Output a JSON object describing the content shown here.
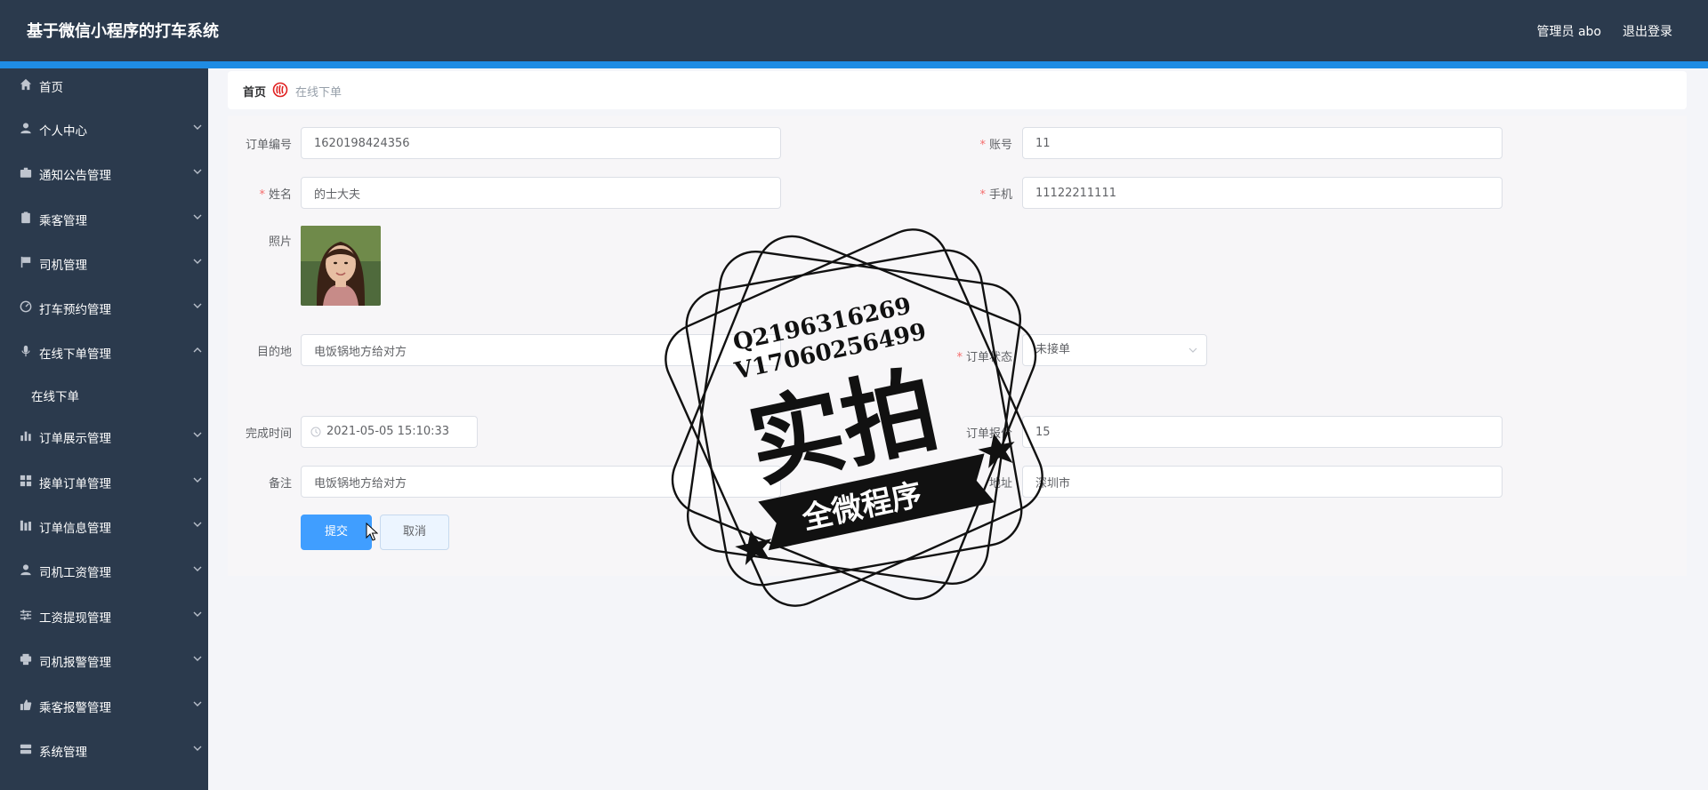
{
  "header": {
    "title": "基于微信小程序的打车系统",
    "user": "管理员 abo",
    "logout": "退出登录"
  },
  "sidebar": {
    "items": [
      {
        "label": "首页",
        "icon": "home-icon"
      },
      {
        "label": "个人中心",
        "icon": "user-icon"
      },
      {
        "label": "通知公告管理",
        "icon": "briefcase-icon"
      },
      {
        "label": "乘客管理",
        "icon": "clipboard-icon"
      },
      {
        "label": "司机管理",
        "icon": "flag-icon"
      },
      {
        "label": "打车预约管理",
        "icon": "gauge-icon"
      },
      {
        "label": "在线下单管理",
        "icon": "mic-icon"
      },
      {
        "label": "在线下单",
        "icon": ""
      },
      {
        "label": "订单展示管理",
        "icon": "bar-chart-icon"
      },
      {
        "label": "接单订单管理",
        "icon": "grid-icon"
      },
      {
        "label": "订单信息管理",
        "icon": "columns-icon"
      },
      {
        "label": "司机工资管理",
        "icon": "user-icon"
      },
      {
        "label": "工资提现管理",
        "icon": "sliders-icon"
      },
      {
        "label": "司机报警管理",
        "icon": "printer-icon"
      },
      {
        "label": "乘客报警管理",
        "icon": "thumb-icon"
      },
      {
        "label": "系统管理",
        "icon": "server-icon"
      }
    ]
  },
  "breadcrumb": {
    "home": "首页",
    "current": "在线下单"
  },
  "form": {
    "order_no": {
      "label": "订单编号",
      "value": "1620198424356"
    },
    "account": {
      "label": "账号",
      "value": "11"
    },
    "name": {
      "label": "姓名",
      "value": "的士大夫"
    },
    "phone": {
      "label": "手机",
      "value": "11122211111"
    },
    "photo": {
      "label": "照片"
    },
    "destination": {
      "label": "目的地",
      "value": "电饭锅地方给对方"
    },
    "status": {
      "label": "订单状态",
      "value": "未接单"
    },
    "finish_time": {
      "label": "完成时间",
      "value": "2021-05-05 15:10:33"
    },
    "price": {
      "label": "订单报价",
      "value": "15"
    },
    "remark": {
      "label": "备注",
      "value": "电饭锅地方给对方"
    },
    "address": {
      "label": "地址",
      "value": "深圳市"
    },
    "submit": "提交",
    "cancel": "取消"
  },
  "stamp": {
    "line1": "Q2196316269",
    "line2": "V17060256499",
    "big": "实拍",
    "banner": "全微程序"
  }
}
